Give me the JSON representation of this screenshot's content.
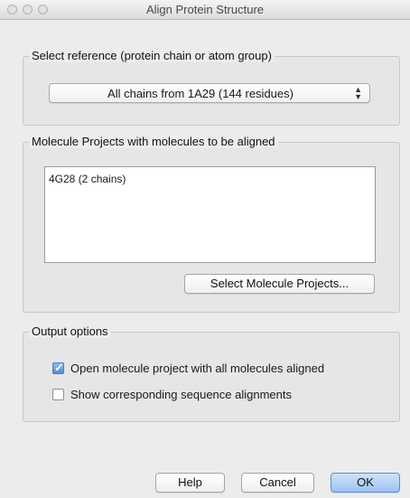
{
  "window": {
    "title": "Align Protein Structure"
  },
  "reference": {
    "legend": "Select reference (protein chain or atom group)",
    "selected": "All chains from 1A29 (144 residues)"
  },
  "projects": {
    "legend": "Molecule Projects with molecules to be aligned",
    "items": [
      "4G28 (2 chains)"
    ],
    "select_button": "Select Molecule Projects..."
  },
  "output": {
    "legend": "Output options",
    "options": [
      {
        "label": "Open molecule project with all molecules aligned",
        "checked": true
      },
      {
        "label": "Show corresponding sequence alignments",
        "checked": false
      }
    ]
  },
  "buttons": {
    "help": "Help",
    "cancel": "Cancel",
    "ok": "OK"
  },
  "colors": {
    "accent": "#4e8fdc",
    "default_button": "#9cc3f2"
  }
}
